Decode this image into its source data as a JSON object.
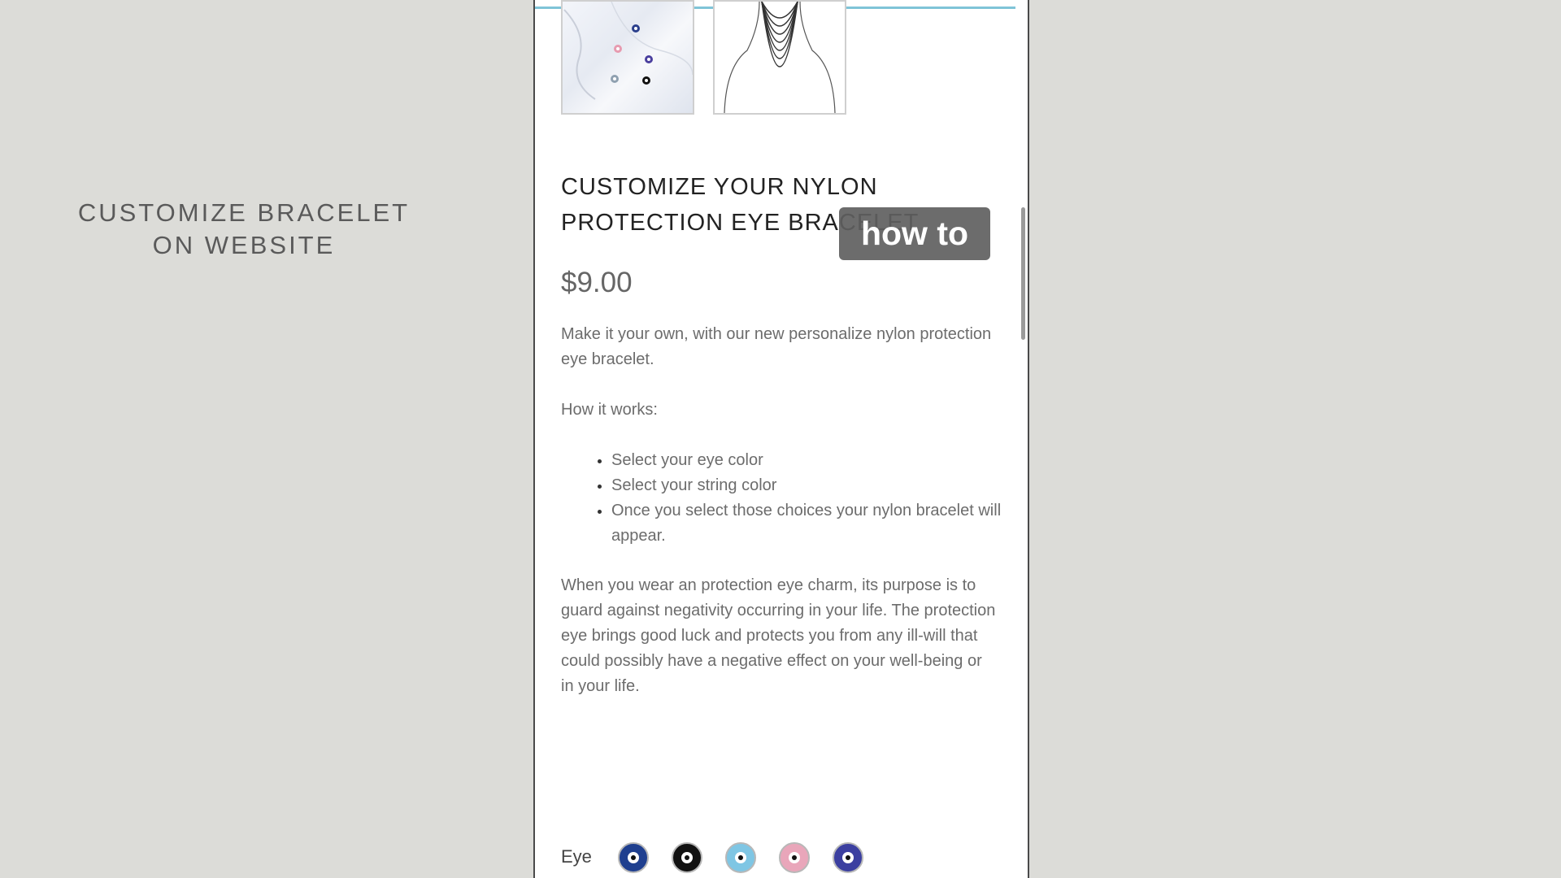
{
  "side_caption": {
    "line1": "CUSTOMIZE BRACELET",
    "line2": "ON WEBSITE"
  },
  "overlay": {
    "label": "how to"
  },
  "product": {
    "title": "CUSTOMIZE YOUR NYLON PROTECTION EYE BRACELET",
    "price": "$9.00",
    "intro": "Make it your own, with our new personalize nylon protection eye bracelet.",
    "how_it_works_heading": "How it works:",
    "steps": [
      "Select your eye color",
      "Select your string color",
      "Once you select those choices your nylon bracelet will appear."
    ],
    "description": "When you wear an protection eye charm, its purpose is to guard against negativity occurring in your life. The protection eye brings good luck and protects you from any ill-will that could possibly have a negative effect on your well-being or in your life."
  },
  "eye_selector": {
    "label": "Eye",
    "swatches": [
      {
        "name": "dark-blue",
        "color": "#1f3f8f"
      },
      {
        "name": "black",
        "color": "#111111"
      },
      {
        "name": "light-blue",
        "color": "#7fc6e4"
      },
      {
        "name": "pink",
        "color": "#e9a6ba"
      },
      {
        "name": "purple",
        "color": "#3b3fa0"
      }
    ]
  },
  "colors": {
    "accent_bar": "#7fc4d8",
    "overlay_bg": "#5f5f5f"
  }
}
